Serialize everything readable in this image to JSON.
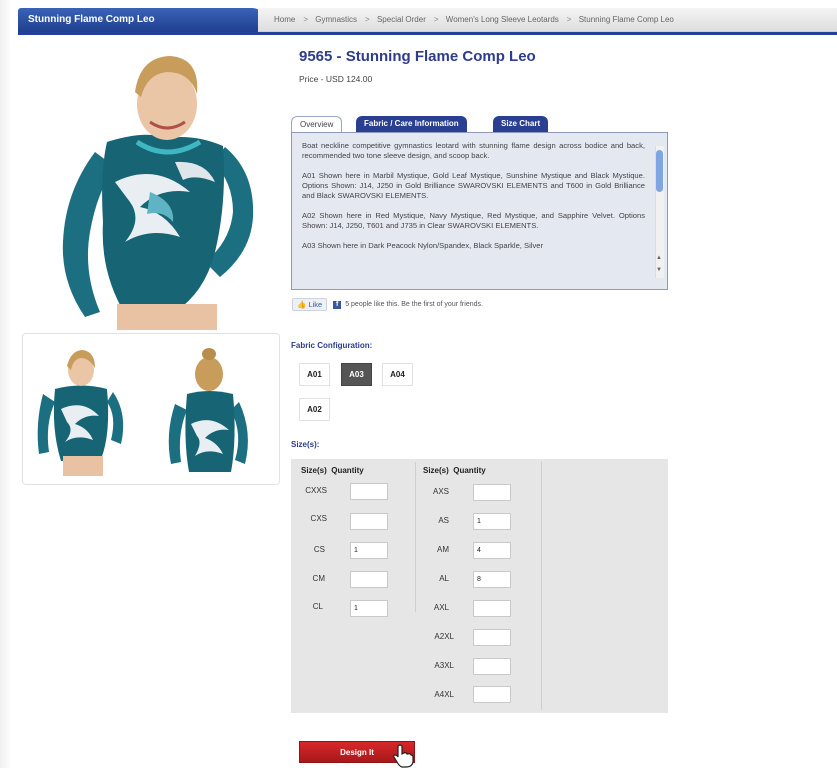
{
  "header": {
    "product_tab": "Stunning Flame Comp Leo",
    "breadcrumb": [
      "Home",
      "Gymnastics",
      "Special Order",
      "Women's Long Sleeve Leotards",
      "Stunning Flame Comp Leo"
    ],
    "separator": ">"
  },
  "product": {
    "title": "9565 - Stunning Flame Comp Leo",
    "price": "Price - USD 124.00"
  },
  "tabs": {
    "overview": "Overview",
    "fabric": "Fabric / Care Information",
    "size_chart": "Size Chart"
  },
  "description": [
    "Boat neckline competitive gymnastics leotard with stunning flame design across bodice and back, recommended two tone sleeve design, and scoop back.",
    "A01 Shown here in Marbil Mystique, Gold Leaf Mystique, Sunshine Mystique and Black Mystique. Options Shown: J14, J250 in Gold Brilliance SWAROVSKI ELEMENTS and T600 in Gold Brilliance and Black SWAROVSKI ELEMENTS.",
    "A02 Shown here in Red Mystique, Navy Mystique, Red Mystique, and Sapphire Velvet. Options Shown: J14, J250, T601 and J735 in Clear SWAROVSKI ELEMENTS.",
    "A03 Shown here in Dark Peacock Nylon/Spandex, Black Sparkle, Silver"
  ],
  "social": {
    "like_label": "Like",
    "like_text": "5 people like this. Be the first of your friends."
  },
  "fabric_config": {
    "label": "Fabric Configuration:",
    "options": [
      "A01",
      "A03",
      "A04",
      "A02"
    ],
    "selected": "A03"
  },
  "sizes": {
    "label": "Size(s):",
    "col_size": "Size(s)",
    "col_qty": "Quantity",
    "left": [
      {
        "size": "CXXS",
        "qty": ""
      },
      {
        "size": "CXS",
        "qty": ""
      },
      {
        "size": "CS",
        "qty": "1"
      },
      {
        "size": "CM",
        "qty": ""
      },
      {
        "size": "CL",
        "qty": "1"
      }
    ],
    "right": [
      {
        "size": "AXS",
        "qty": ""
      },
      {
        "size": "AS",
        "qty": "1"
      },
      {
        "size": "AM",
        "qty": "4"
      },
      {
        "size": "AL",
        "qty": "8"
      },
      {
        "size": "AXL",
        "qty": ""
      },
      {
        "size": "A2XL",
        "qty": ""
      },
      {
        "size": "A3XL",
        "qty": ""
      },
      {
        "size": "A4XL",
        "qty": ""
      }
    ]
  },
  "actions": {
    "design_it": "Design It"
  },
  "colors": {
    "brand_blue": "#23409a",
    "title_blue": "#2d3c8c",
    "button_red": "#c21f22",
    "leotard_teal": "#1c6f80"
  }
}
